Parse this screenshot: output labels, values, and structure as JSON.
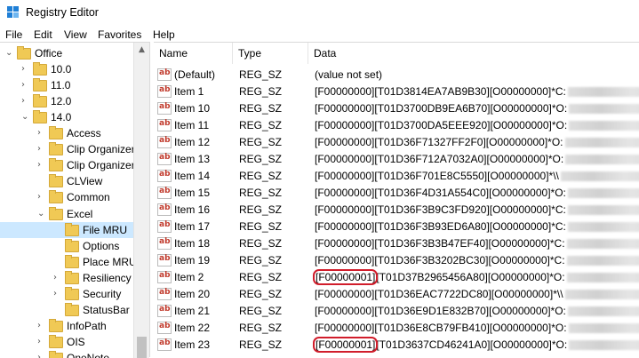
{
  "window": {
    "title": "Registry Editor"
  },
  "menu": [
    "File",
    "Edit",
    "View",
    "Favorites",
    "Help"
  ],
  "tree": {
    "items": [
      {
        "label": "Office",
        "depth": 0,
        "expanded": true
      },
      {
        "label": "10.0",
        "depth": 1,
        "expanded": false
      },
      {
        "label": "11.0",
        "depth": 1,
        "expanded": false
      },
      {
        "label": "12.0",
        "depth": 1,
        "expanded": false
      },
      {
        "label": "14.0",
        "depth": 1,
        "expanded": true
      },
      {
        "label": "Access",
        "depth": 2,
        "expanded": false
      },
      {
        "label": "Clip Organizer",
        "depth": 2,
        "expanded": false
      },
      {
        "label": "Clip OrganizerDE",
        "depth": 2,
        "expanded": false
      },
      {
        "label": "CLView",
        "depth": 2,
        "expanded": null
      },
      {
        "label": "Common",
        "depth": 2,
        "expanded": false
      },
      {
        "label": "Excel",
        "depth": 2,
        "expanded": true
      },
      {
        "label": "File MRU",
        "depth": 3,
        "expanded": null,
        "selected": true
      },
      {
        "label": "Options",
        "depth": 3,
        "expanded": null
      },
      {
        "label": "Place MRU",
        "depth": 3,
        "expanded": null
      },
      {
        "label": "Resiliency",
        "depth": 3,
        "expanded": false
      },
      {
        "label": "Security",
        "depth": 3,
        "expanded": false
      },
      {
        "label": "StatusBar",
        "depth": 3,
        "expanded": null
      },
      {
        "label": "InfoPath",
        "depth": 2,
        "expanded": false
      },
      {
        "label": "OIS",
        "depth": 2,
        "expanded": false
      },
      {
        "label": "OneNote",
        "depth": 2,
        "expanded": false
      }
    ]
  },
  "list": {
    "columns": [
      "Name",
      "Type",
      "Data"
    ],
    "rows": [
      {
        "name": "(Default)",
        "type": "REG_SZ",
        "data_prefix": "",
        "data": "(value not set)",
        "blurred": false,
        "highlight": false
      },
      {
        "name": "Item 1",
        "type": "REG_SZ",
        "data_prefix": "[F00000000]",
        "data": "[T01D3814EA7AB9B30][O00000000]*C:",
        "blurred": true,
        "highlight": false
      },
      {
        "name": "Item 10",
        "type": "REG_SZ",
        "data_prefix": "[F00000000]",
        "data": "[T01D3700DB9EA6B70][O00000000]*O:",
        "blurred": true,
        "highlight": false
      },
      {
        "name": "Item 11",
        "type": "REG_SZ",
        "data_prefix": "[F00000000]",
        "data": "[T01D3700DA5EEE920][O00000000]*O:",
        "blurred": true,
        "highlight": false
      },
      {
        "name": "Item 12",
        "type": "REG_SZ",
        "data_prefix": "[F00000000]",
        "data": "[T01D36F71327FF2F0][O00000000]*O:",
        "blurred": true,
        "highlight": false
      },
      {
        "name": "Item 13",
        "type": "REG_SZ",
        "data_prefix": "[F00000000]",
        "data": "[T01D36F712A7032A0][O00000000]*O:",
        "blurred": true,
        "highlight": false
      },
      {
        "name": "Item 14",
        "type": "REG_SZ",
        "data_prefix": "[F00000000]",
        "data": "[T01D36F701E8C5550][O00000000]*\\\\",
        "blurred": true,
        "highlight": false
      },
      {
        "name": "Item 15",
        "type": "REG_SZ",
        "data_prefix": "[F00000000]",
        "data": "[T01D36F4D31A554C0][O00000000]*O:",
        "blurred": true,
        "highlight": false
      },
      {
        "name": "Item 16",
        "type": "REG_SZ",
        "data_prefix": "[F00000000]",
        "data": "[T01D36F3B9C3FD920][O00000000]*C:",
        "blurred": true,
        "highlight": false
      },
      {
        "name": "Item 17",
        "type": "REG_SZ",
        "data_prefix": "[F00000000]",
        "data": "[T01D36F3B93ED6A80][O00000000]*C:",
        "blurred": true,
        "highlight": false
      },
      {
        "name": "Item 18",
        "type": "REG_SZ",
        "data_prefix": "[F00000000]",
        "data": "[T01D36F3B3B47EF40][O00000000]*C:",
        "blurred": true,
        "highlight": false
      },
      {
        "name": "Item 19",
        "type": "REG_SZ",
        "data_prefix": "[F00000000]",
        "data": "[T01D36F3B3202BC30][O00000000]*C:",
        "blurred": true,
        "highlight": false
      },
      {
        "name": "Item 2",
        "type": "REG_SZ",
        "data_prefix": "[F00000001]",
        "data": "[T01D37B2965456A80][O00000000]*O:",
        "blurred": true,
        "highlight": true
      },
      {
        "name": "Item 20",
        "type": "REG_SZ",
        "data_prefix": "[F00000000]",
        "data": "[T01D36EAC7722DC80][O00000000]*\\\\",
        "blurred": true,
        "highlight": false
      },
      {
        "name": "Item 21",
        "type": "REG_SZ",
        "data_prefix": "[F00000000]",
        "data": "[T01D36E9D1E832B70][O00000000]*O:",
        "blurred": true,
        "highlight": false
      },
      {
        "name": "Item 22",
        "type": "REG_SZ",
        "data_prefix": "[F00000000]",
        "data": "[T01D36E8CB79FB410][O00000000]*O:",
        "blurred": true,
        "highlight": false
      },
      {
        "name": "Item 23",
        "type": "REG_SZ",
        "data_prefix": "[F00000001]",
        "data": "[T01D3637CD46241A0][O00000000]*O:",
        "blurred": true,
        "highlight": true
      }
    ]
  },
  "colors": {
    "selection": "#cce8ff",
    "highlight_outline": "#d11d2b",
    "folder": "#f0c955",
    "reg_icon_text": "#c0392b"
  }
}
